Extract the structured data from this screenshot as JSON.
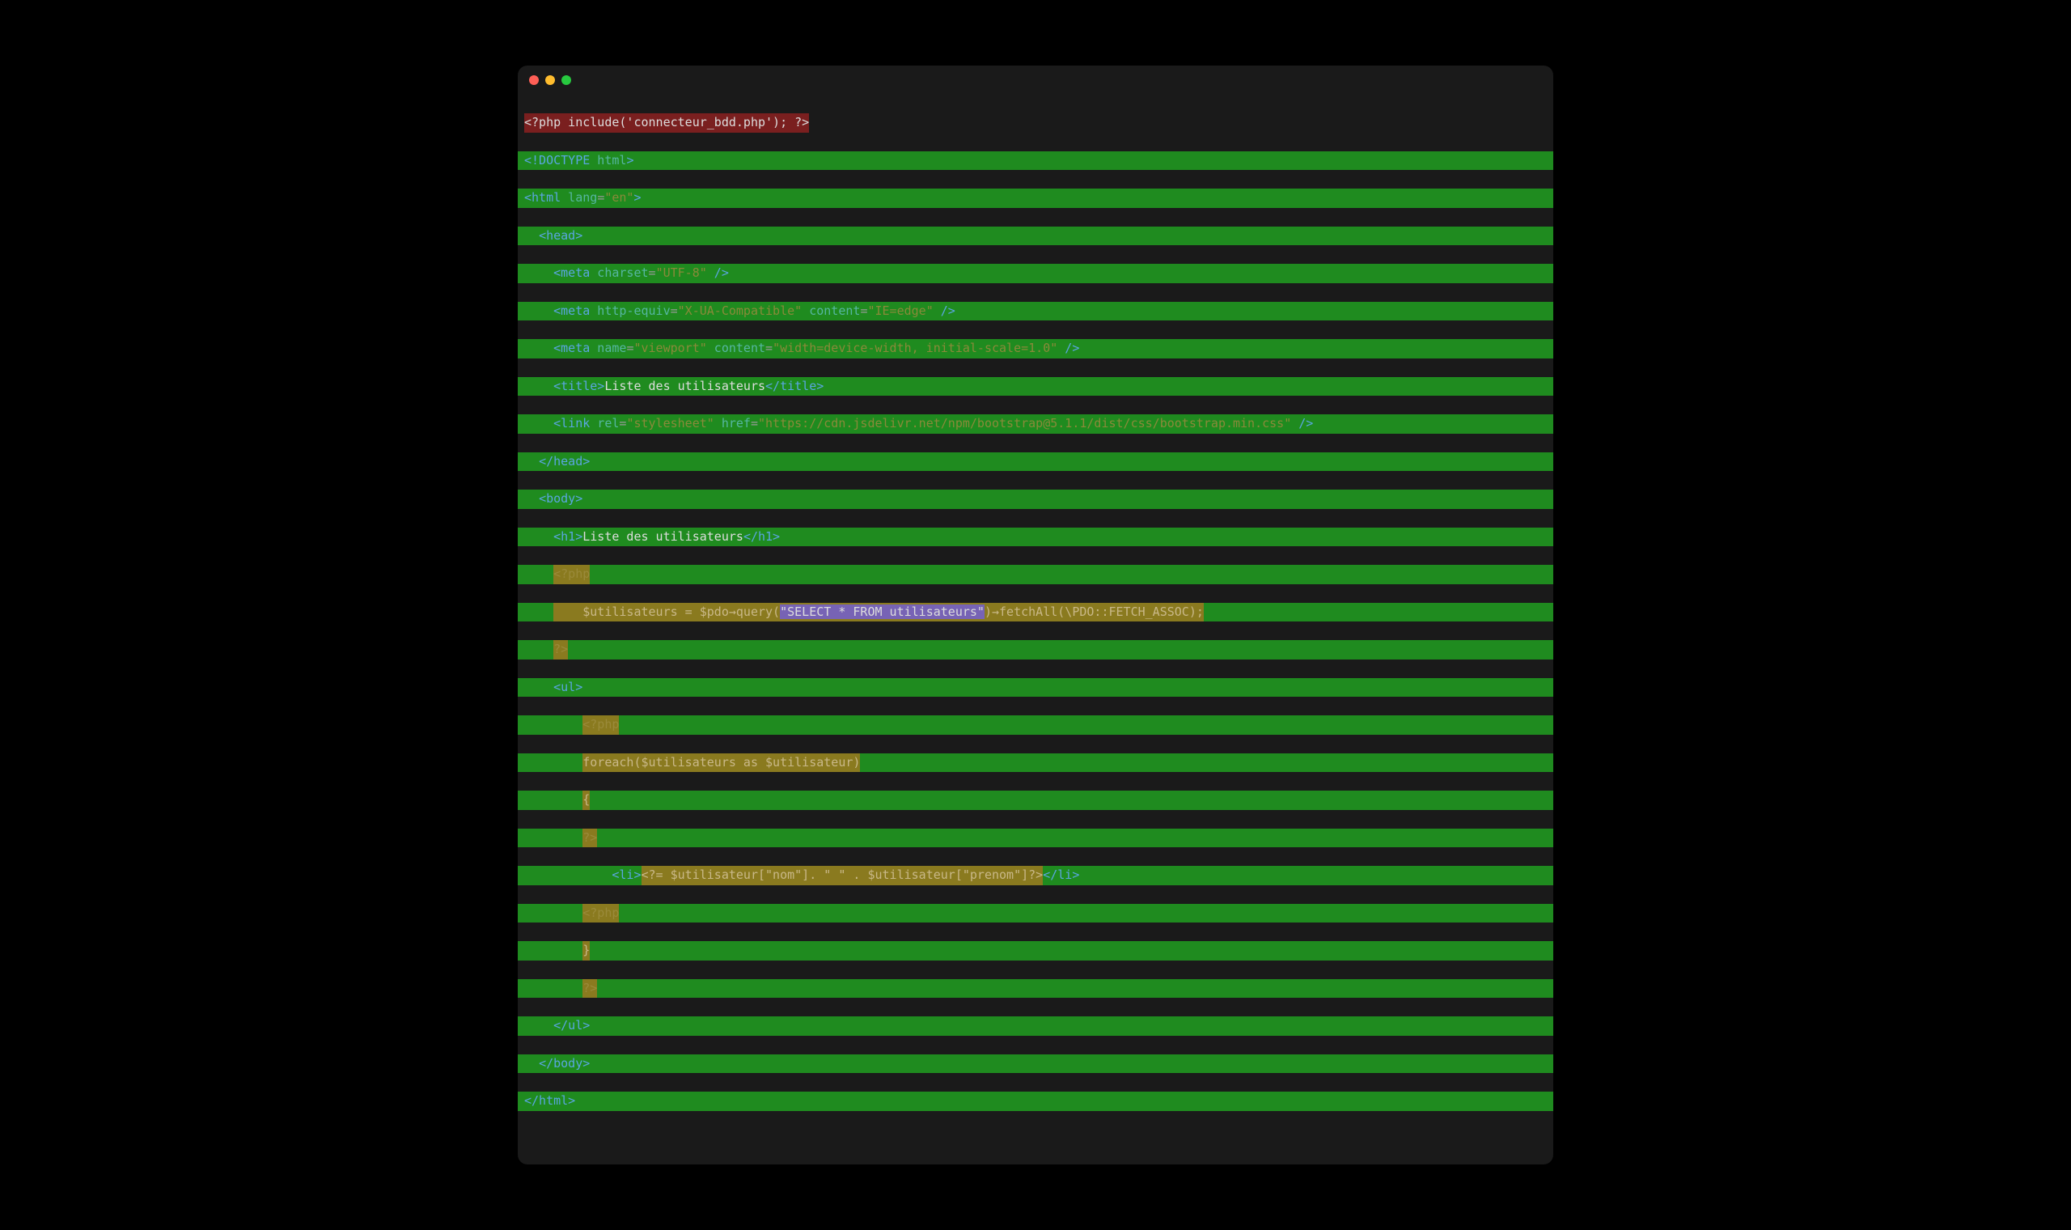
{
  "code": {
    "php_include": "<?php include('connecteur_bdd.php'); ?>",
    "doctype_open": "<!DOCTYPE",
    "doctype_html": " html",
    "doctype_close": ">",
    "html_open": "<html",
    "lang_attr": " lang",
    "lang_eq": "=",
    "lang_val": "\"en\"",
    "tag_close": ">",
    "head_open": "<head>",
    "meta1_open": "<meta",
    "meta1_charset": " charset",
    "meta1_val": "\"UTF-8\"",
    "self_close": " />",
    "meta2_open": "<meta",
    "meta2_httpequiv": " http-equiv",
    "meta2_httpequiv_val": "\"X-UA-Compatible\"",
    "meta2_content": " content",
    "meta2_content_val": "\"IE=edge\"",
    "meta3_open": "<meta",
    "meta3_name": " name",
    "meta3_name_val": "\"viewport\"",
    "meta3_content": " content",
    "meta3_content_val": "\"width=device-width, initial-scale=1.0\"",
    "title_open": "<title>",
    "title_text": "Liste des utilisateurs",
    "title_close": "</title>",
    "link_open": "<link",
    "link_rel": " rel",
    "link_rel_val": "\"stylesheet\"",
    "link_href": " href",
    "link_href_val": "\"https://cdn.jsdelivr.net/npm/bootstrap@5.1.1/dist/css/bootstrap.min.css\"",
    "head_close": "</head>",
    "body_open": "<body>",
    "h1_open": "<h1>",
    "h1_text": "Liste des utilisateurs",
    "h1_close": "</h1>",
    "php_query_open": "<?php",
    "php_query_line": "    $utilisateurs = $pdo→query(",
    "php_sql": "\"SELECT * FROM utilisateurs\"",
    "php_query_end": ")→fetchAll(\\PDO::FETCH_ASSOC);",
    "php_close": "?>",
    "ul_open": "<ul>",
    "php_foreach_open": "<?php",
    "php_foreach": "foreach($utilisateurs as $utilisateur)",
    "php_brace_open": "{",
    "li_open": "<li>",
    "php_echo": "<?= $utilisateur[\"nom\"]. \" \" . $utilisateur[\"prenom\"]?>",
    "li_close": "</li>",
    "php_brace_close": "}",
    "ul_close": "</ul>",
    "body_close": "</body>",
    "html_close": "</html>"
  }
}
